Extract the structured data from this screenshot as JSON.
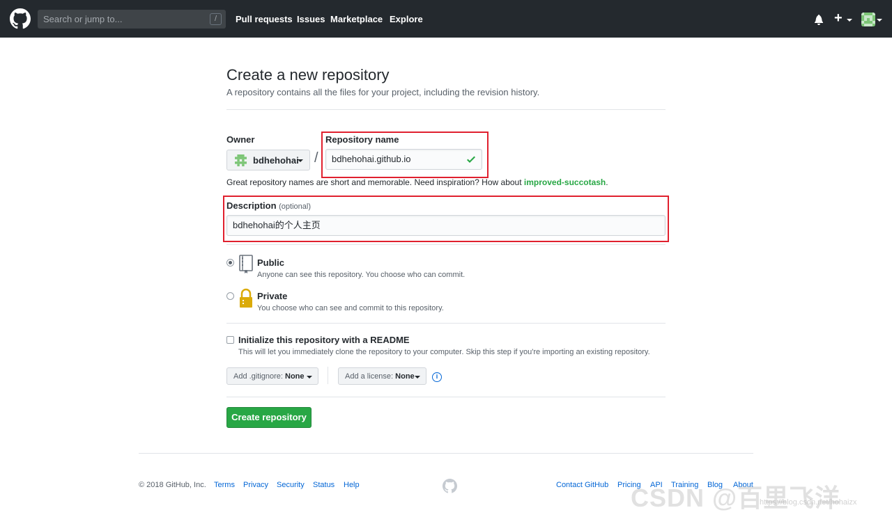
{
  "header": {
    "search_placeholder": "Search or jump to...",
    "search_shortcut": "/",
    "nav": [
      "Pull requests",
      "Issues",
      "Marketplace",
      "Explore"
    ],
    "plus_label": "+"
  },
  "page": {
    "title": "Create a new repository",
    "subtitle": "A repository contains all the files for your project, including the revision history."
  },
  "form": {
    "owner_label": "Owner",
    "owner_value": "bdhehohai",
    "slash": "/",
    "repo_label": "Repository name",
    "repo_value": "bdhehohai.github.io",
    "hint_text": "Great repository names are short and memorable. Need inspiration? How about ",
    "hint_suggestion": "improved-succotash",
    "hint_end": ".",
    "desc_label": "Description",
    "desc_optional": "(optional)",
    "desc_value": "bdhehohai的个人主页",
    "visibility": [
      {
        "title": "Public",
        "desc": "Anyone can see this repository. You choose who can commit.",
        "selected": true
      },
      {
        "title": "Private",
        "desc": "You choose who can see and commit to this repository.",
        "selected": false
      }
    ],
    "readme_label": "Initialize this repository with a README",
    "readme_desc": "This will let you immediately clone the repository to your computer. Skip this step if you're importing an existing repository.",
    "gitignore_label": "Add .gitignore:",
    "gitignore_value": "None",
    "license_label": "Add a license:",
    "license_value": "None",
    "info_glyph": "i",
    "create_button": "Create repository"
  },
  "footer": {
    "copyright": "© 2018 GitHub, Inc.",
    "left_links": [
      "Terms",
      "Privacy",
      "Security",
      "Status",
      "Help"
    ],
    "right_links": [
      "Contact GitHub",
      "Pricing",
      "API",
      "Training",
      "Blog",
      "About"
    ]
  },
  "watermark": {
    "main": "CSDN @百里飞洋",
    "url": "https://blog.csdn.net/hohaizx"
  },
  "colors": {
    "header_bg": "#24292e",
    "accent_green": "#28a745",
    "link_blue": "#0366d6",
    "highlight_red": "#e0202e"
  }
}
